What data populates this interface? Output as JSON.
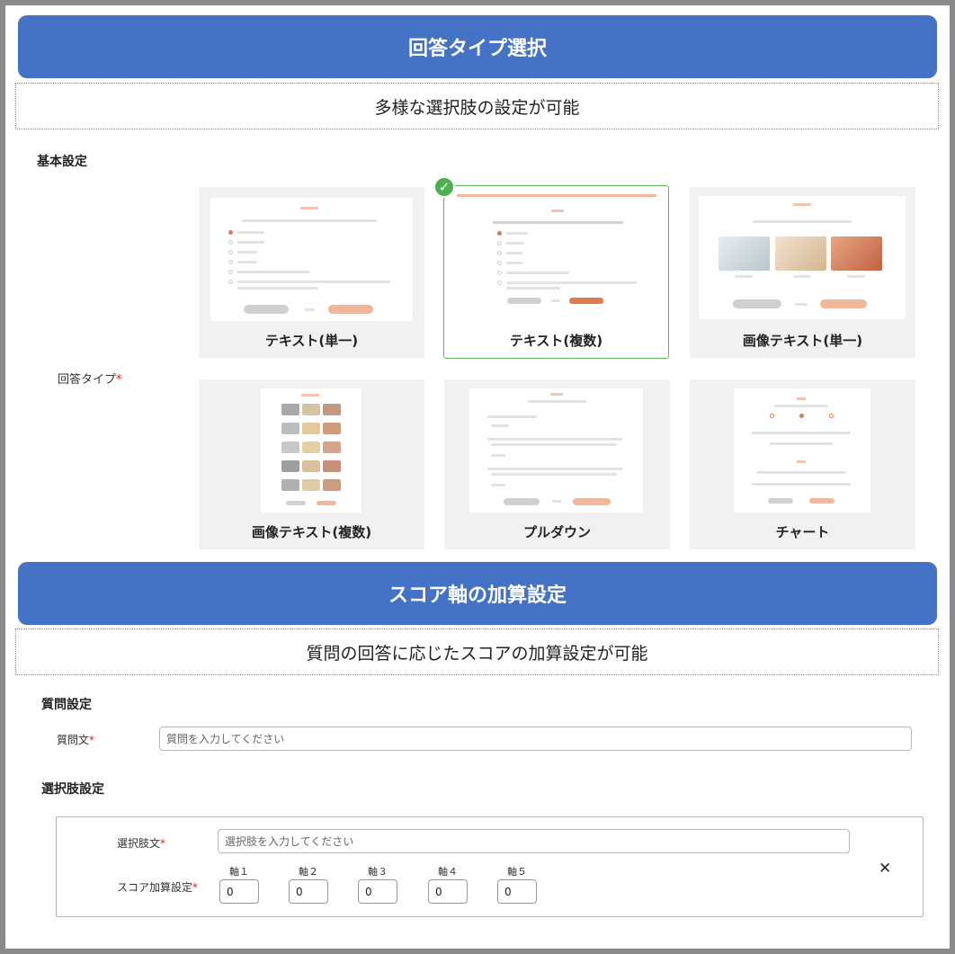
{
  "section1": {
    "title": "回答タイプ選択",
    "subtitle": "多様な選択肢の設定が可能",
    "basic_settings_label": "基本設定",
    "answer_type_label": "回答タイプ",
    "required_mark": "*",
    "cards": [
      {
        "caption": "テキスト(単一)",
        "selected": false
      },
      {
        "caption": "テキスト(複数)",
        "selected": true
      },
      {
        "caption": "画像テキスト(単一)",
        "selected": false
      },
      {
        "caption": "画像テキスト(複数)",
        "selected": false
      },
      {
        "caption": "プルダウン",
        "selected": false
      },
      {
        "caption": "チャート",
        "selected": false
      }
    ],
    "check_glyph": "✓"
  },
  "section2": {
    "title": "スコア軸の加算設定",
    "subtitle": "質問の回答に応じたスコアの加算設定が可能",
    "question_settings_label": "質問設定",
    "question_text_label": "質問文",
    "question_placeholder": "質問を入力してください",
    "option_settings_label": "選択肢設定",
    "option_text_label": "選択肢文",
    "option_placeholder": "選択肢を入力してください",
    "score_label": "スコア加算設定",
    "required_mark": "*",
    "axes": [
      {
        "label": "軸１",
        "value": "0"
      },
      {
        "label": "軸２",
        "value": "0"
      },
      {
        "label": "軸３",
        "value": "0"
      },
      {
        "label": "軸４",
        "value": "0"
      },
      {
        "label": "軸５",
        "value": "0"
      }
    ],
    "remove_glyph": "✕"
  },
  "colors": {
    "banner": "#4472c4",
    "selected_border": "#5fb35f",
    "accent_orange": "#e07a4f",
    "required": "#dd2222"
  },
  "icons": {
    "check": "check-icon",
    "remove": "close-icon"
  }
}
